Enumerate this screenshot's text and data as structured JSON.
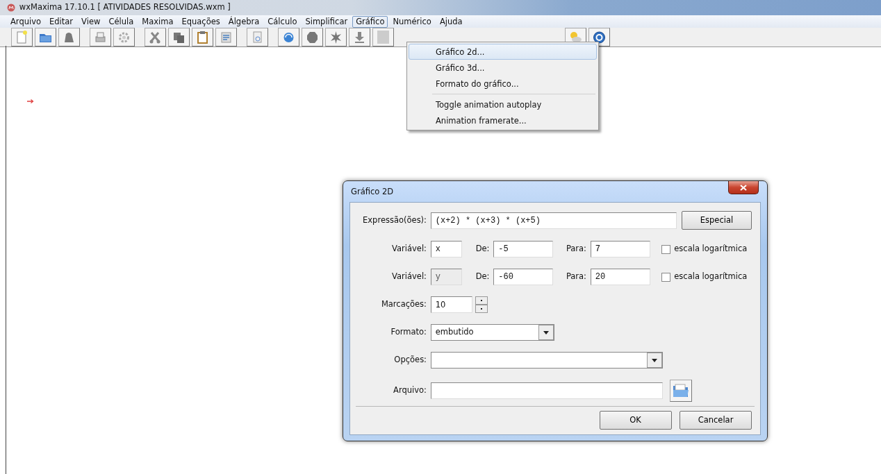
{
  "window": {
    "title": "wxMaxima 17.10.1  [ ATIVIDADES RESOLVIDAS.wxm ]"
  },
  "menu_bar": [
    {
      "label": "Arquivo",
      "selected": false
    },
    {
      "label": "Editar",
      "selected": false
    },
    {
      "label": "View",
      "selected": false
    },
    {
      "label": "Célula",
      "selected": false
    },
    {
      "label": "Maxima",
      "selected": false
    },
    {
      "label": "Equações",
      "selected": false
    },
    {
      "label": "Álgebra",
      "selected": false
    },
    {
      "label": "Cálculo",
      "selected": false
    },
    {
      "label": "Simplificar",
      "selected": false
    },
    {
      "label": "Gráfico",
      "selected": true
    },
    {
      "label": "Numérico",
      "selected": false
    },
    {
      "label": "Ajuda",
      "selected": false
    }
  ],
  "dropdown_menu": {
    "groups": [
      [
        {
          "label": "Gráfico 2d...",
          "selected": true
        },
        {
          "label": "Gráfico 3d...",
          "selected": false
        },
        {
          "label": "Formato do gráfico...",
          "selected": false
        }
      ],
      [
        {
          "label": "Toggle animation autoplay",
          "selected": false
        },
        {
          "label": "Animation framerate...",
          "selected": false
        }
      ]
    ]
  },
  "dialog": {
    "title": "Gráfico 2D",
    "expression": {
      "label": "Expressão(ões):",
      "value": "(x+2) * (x+3) * (x+5)"
    },
    "special_button": "Especial",
    "variables": [
      {
        "label": "Variável:",
        "value": "x",
        "disabled": false,
        "from_label": "De:",
        "from": "-5",
        "to_label": "Para:",
        "to": "7",
        "log_label": "escala logarítmica",
        "checked": false
      },
      {
        "label": "Variável:",
        "value": "y",
        "disabled": true,
        "from_label": "De:",
        "from": "-60",
        "to_label": "Para:",
        "to": "20",
        "log_label": "escala logarítmica",
        "checked": false
      }
    ],
    "ticks": {
      "label": "Marcações:",
      "value": "10"
    },
    "format": {
      "label": "Formato:",
      "value": "embutido"
    },
    "options": {
      "label": "Opções:"
    },
    "file": {
      "label": "Arquivo:"
    },
    "buttons": [
      "OK",
      "Cancelar"
    ]
  }
}
